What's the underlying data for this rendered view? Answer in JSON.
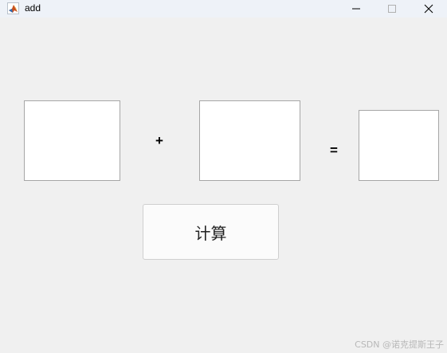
{
  "window": {
    "title": "add",
    "icon": "matlab-icon",
    "controls": {
      "minimize_icon": "minimize-icon",
      "maximize_icon": "maximize-icon",
      "close_icon": "close-icon"
    }
  },
  "form": {
    "operand_a": {
      "value": ""
    },
    "operator_plus": "+",
    "operand_b": {
      "value": ""
    },
    "operator_equals": "=",
    "result": {
      "value": ""
    },
    "calculate_label": "计算"
  },
  "watermark": "CSDN @诺克提斯王子",
  "colors": {
    "window_bg": "#f0f0f0",
    "titlebar_bg": "#eef2f8",
    "field_bg": "#ffffff",
    "field_border": "#a6a6a6",
    "button_bg": "#fbfbfb"
  }
}
